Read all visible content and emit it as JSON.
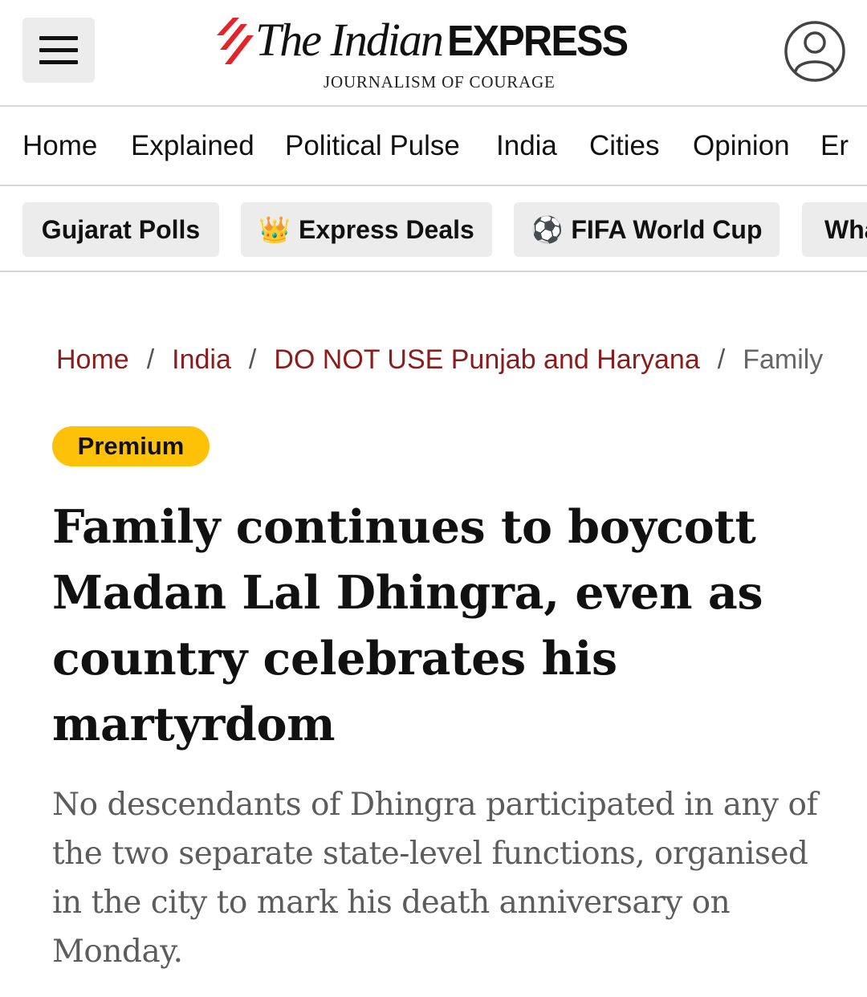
{
  "header": {
    "logo": {
      "the_indian": "The Indian",
      "express": "EXPRESS",
      "tagline": "JOURNALISM OF COURAGE"
    },
    "menu_icon": "hamburger-menu-icon",
    "profile_icon": "user-profile-icon"
  },
  "primary_nav": {
    "items": [
      {
        "label": "Home"
      },
      {
        "label": "Explained"
      },
      {
        "label": "Political Pulse"
      },
      {
        "label": "India"
      },
      {
        "label": "Cities"
      },
      {
        "label": "Opinion"
      },
      {
        "label": "Er"
      }
    ]
  },
  "chips": {
    "items": [
      {
        "label": "Gujarat Polls",
        "icon": ""
      },
      {
        "label": "Express Deals",
        "icon": "👑"
      },
      {
        "label": "FIFA World Cup",
        "icon": "⚽"
      },
      {
        "label": "Wha",
        "icon": ""
      }
    ]
  },
  "breadcrumb": {
    "items": [
      {
        "label": "Home"
      },
      {
        "label": "India"
      },
      {
        "label": "DO NOT USE Punjab and Haryana"
      },
      {
        "label": "Family"
      }
    ],
    "separator": "/"
  },
  "article": {
    "badge": "Premium",
    "headline": "Family continues to boycott Madan Lal Dhingra, even as country celebrates his martyrdom",
    "subhead": "No descendants of Dhingra participated in any of the two separate state-level functions, organised in the city to mark his death anniversary on Monday."
  },
  "colors": {
    "brand_red": "#e3242b",
    "breadcrumb_link": "#8b1c1c",
    "premium_badge": "#fdc107",
    "chip_bg": "#ececec"
  }
}
